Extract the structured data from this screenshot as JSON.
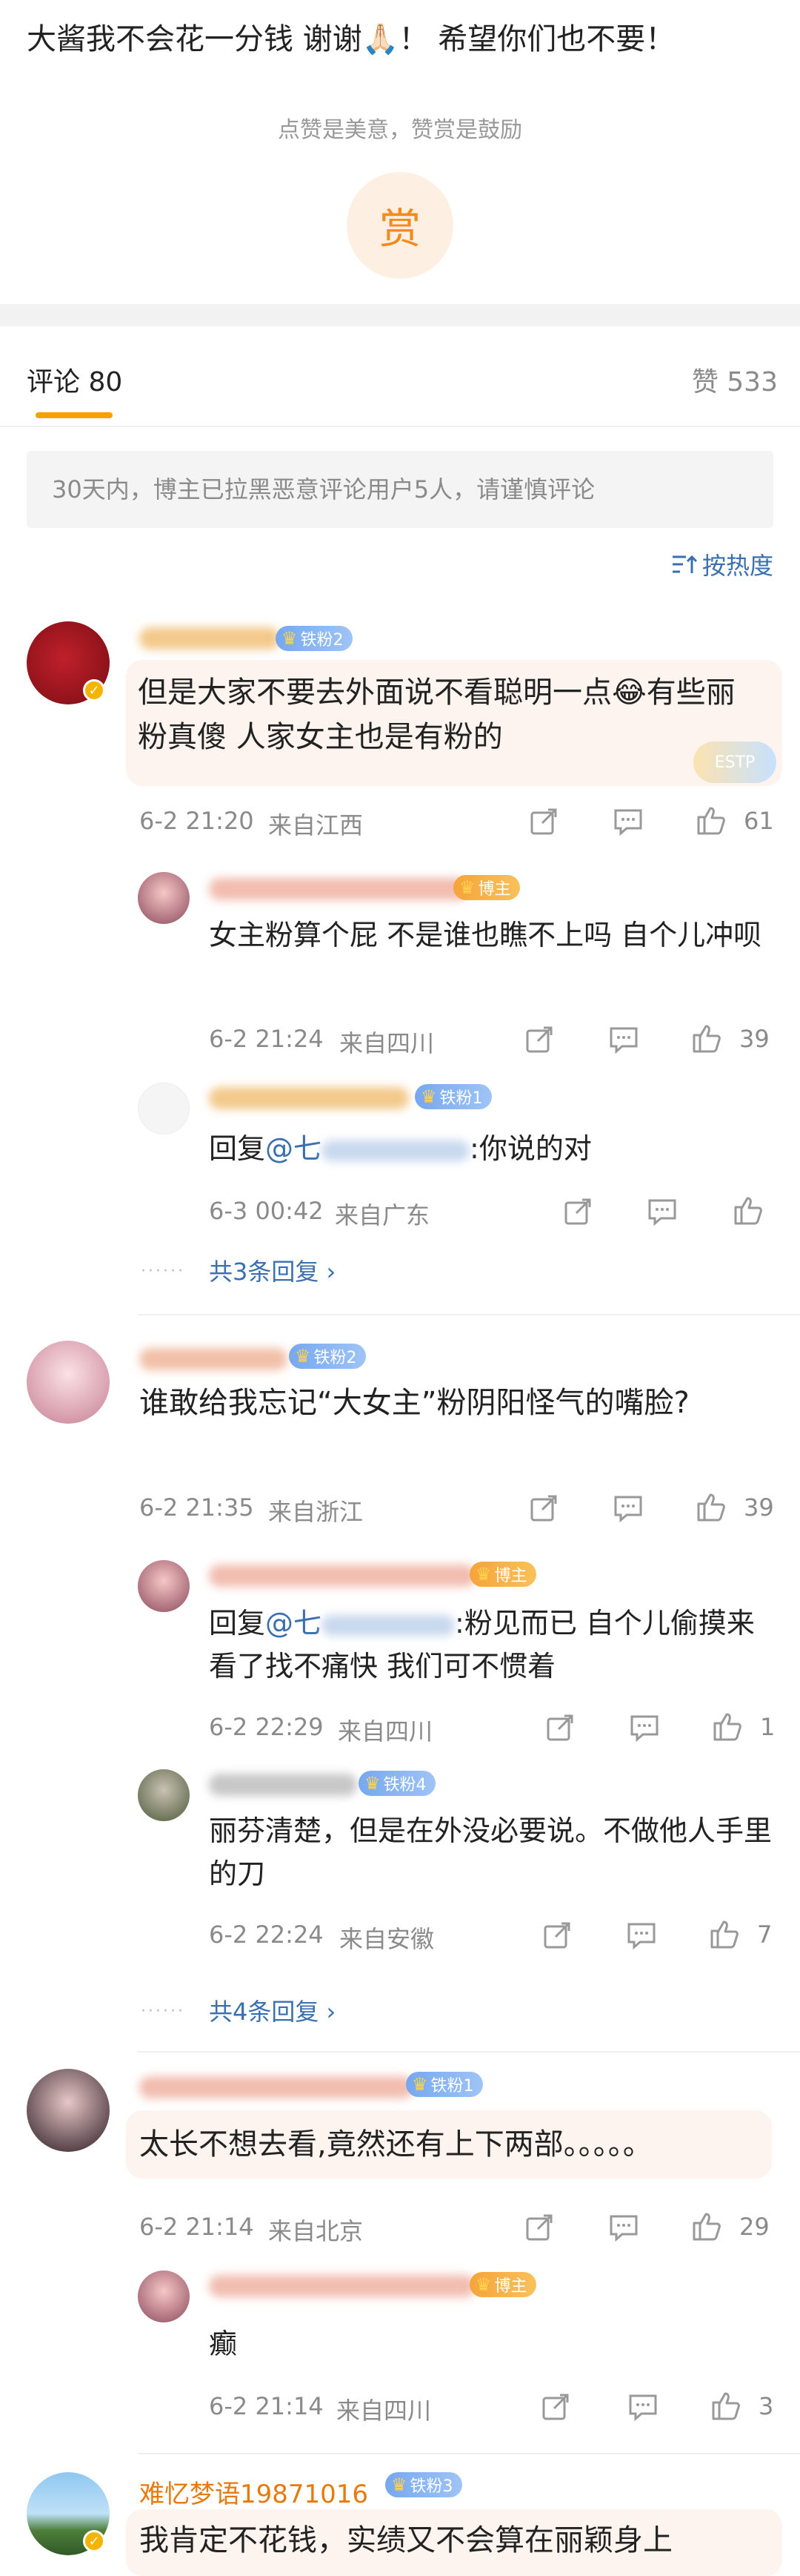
{
  "post": {
    "body_text": "大酱我不会花一分钱 谢谢🙏🏻！ 希望你们也不要！",
    "reward_tip": "点赞是美意，赞赏是鼓励",
    "reward_button": "赏"
  },
  "tabs": {
    "comments_label": "评论 80",
    "likes_label": "赞 533"
  },
  "notice": "30天内，博主已拉黑恶意评论用户5人，请谨慎评论",
  "sort_label": "按热度",
  "badges": {
    "fans1": "铁粉1",
    "fans2": "铁粉2",
    "fans3": "铁粉3",
    "fans4": "铁粉4",
    "host": "博主"
  },
  "comments": [
    {
      "text": "但是大家不要去外面说不看聪明一点😂有些丽粉真傻  人家女主也是有粉的",
      "time": "6-2 21:20",
      "location": "来自江西",
      "likes": "61",
      "replies": [
        {
          "text": "女主粉算个屁 不是谁也瞧不上吗 自个儿冲呗",
          "time": "6-2 21:24",
          "location": "来自四川",
          "likes": "39"
        },
        {
          "reply_prefix": "回复",
          "mention": "@七",
          "text": ":你说的对",
          "time": "6-3 00:42",
          "location": "来自广东",
          "likes": ""
        }
      ],
      "more_replies": "共3条回复"
    },
    {
      "text": "谁敢给我忘记“大女主”粉阴阳怪气的嘴脸?",
      "time": "6-2 21:35",
      "location": "来自浙江",
      "likes": "39",
      "replies": [
        {
          "reply_prefix": "回复",
          "mention": "@七",
          "text": ":粉见而已 自个儿偷摸来看了找不痛快 我们可不惯着",
          "time": "6-2 22:29",
          "location": "来自四川",
          "likes": "1"
        },
        {
          "text": "丽芬清楚，但是在外没必要说。不做他人手里的刀",
          "time": "6-2 22:24",
          "location": "来自安徽",
          "likes": "7"
        }
      ],
      "more_replies": "共4条回复"
    },
    {
      "text": "太长不想去看,竟然还有上下两部。。。。。",
      "time": "6-2 21:14",
      "location": "来自北京",
      "likes": "29",
      "replies": [
        {
          "text": "癫",
          "time": "6-2 21:14",
          "location": "来自四川",
          "likes": "3"
        }
      ]
    },
    {
      "name": "难忆梦语19871016",
      "text": "我肯定不花钱，实绩又不会算在丽颖身上"
    }
  ],
  "colors": {
    "accent_orange": "#f7a100",
    "link_blue": "#3a6fb0",
    "meta_gray": "#8a8a8a"
  }
}
